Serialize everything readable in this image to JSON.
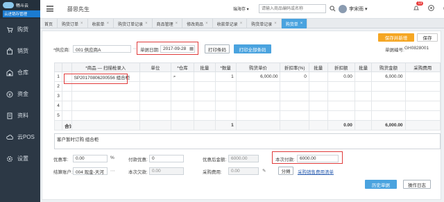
{
  "app": {
    "logo_text": "畅斗云",
    "logo_sub": "云进销存管理",
    "greeting": "薛思先生"
  },
  "sidebar": {
    "items": [
      {
        "label": "购货",
        "icon": "cart-icon"
      },
      {
        "label": "销货",
        "icon": "sales-icon"
      },
      {
        "label": "仓库",
        "icon": "warehouse-icon"
      },
      {
        "label": "资金",
        "icon": "money-icon"
      },
      {
        "label": "资料",
        "icon": "data-icon"
      },
      {
        "label": "云POS",
        "icon": "pos-icon"
      },
      {
        "label": "设置",
        "icon": "gear-icon"
      }
    ]
  },
  "header": {
    "store": "瑞海存 ▾",
    "search_placeholder": "请输入商品编码或名称",
    "user": "李宋雨 ▾",
    "badge": "13"
  },
  "tabs": [
    {
      "label": "首页",
      "active": false,
      "close": false
    },
    {
      "label": "购货订单",
      "active": false,
      "close": true
    },
    {
      "label": "收款单",
      "active": false,
      "close": true
    },
    {
      "label": "购货订单记录",
      "active": false,
      "close": true
    },
    {
      "label": "商品管理",
      "active": false,
      "close": true
    },
    {
      "label": "修改商品",
      "active": false,
      "close": true
    },
    {
      "label": "收款单记录",
      "active": false,
      "close": true
    },
    {
      "label": "购货单记录",
      "active": false,
      "close": true
    },
    {
      "label": "购货单",
      "active": true,
      "close": true
    }
  ],
  "form": {
    "save_add": "保存并新增",
    "save": "保存",
    "supplier_label": "*供应商:",
    "supplier_value": "001 供应商A",
    "date_label": "单据日期:",
    "date_value": "2017-09-28",
    "print_barcode": "打印条码",
    "print_all_barcode": "打印全部条码",
    "doc_no_label": "单据编号:",
    "doc_no_value": "GH0828001"
  },
  "table": {
    "headers": [
      "",
      "",
      "*商品 — 扫描枪录入",
      "单位",
      "*仓库",
      "批量",
      "*数量",
      "购货单价",
      "折扣率(%)",
      "批量",
      "折扣额",
      "批量",
      "购货金额",
      "采购费用"
    ],
    "rows": [
      [
        "1",
        "",
        "SP20170806200556 组合柜",
        "",
        "",
        "",
        "1",
        "6,000.00",
        "0",
        "",
        "0.00",
        "",
        "6,000.00",
        ""
      ],
      [
        "2",
        "",
        "",
        "",
        "",
        "",
        "",
        "",
        "",
        "",
        "",
        "",
        "",
        ""
      ],
      [
        "3",
        "",
        "",
        "",
        "",
        "",
        "",
        "",
        "",
        "",
        "",
        "",
        "",
        ""
      ],
      [
        "4",
        "",
        "",
        "",
        "",
        "",
        "",
        "",
        "",
        "",
        "",
        "",
        "",
        ""
      ],
      [
        "5",
        "",
        "",
        "",
        "",
        "",
        "",
        "",
        "",
        "",
        "",
        "",
        "",
        ""
      ]
    ],
    "total": [
      "",
      "合计:",
      "",
      "",
      "",
      "",
      "1",
      "",
      "",
      "",
      "0.00",
      "",
      "6,000.00",
      ""
    ]
  },
  "note": "客户暂时订购 组合柜",
  "footer": {
    "discount_rate_label": "优惠率:",
    "discount_rate_value": "0.00",
    "pct": "%",
    "discount_label": "付款优惠:",
    "discount_value": "0",
    "after_discount_label": "优惠后金额:",
    "after_discount_value": "6000.00",
    "this_pay_label": "本次付款:",
    "this_pay_value": "6000.00",
    "account_label": "结算账户:",
    "account_value": "004 现金-天河",
    "arrears_label": "本次欠款:",
    "arrears_value": "0.00",
    "purchase_fee_label": "采购费用:",
    "purchase_fee_value": "0.00",
    "split_btn": "分摊",
    "fee_link": "采购销售费用清单",
    "history_btn": "历史单据",
    "log_btn": "操作日志"
  },
  "colors": {
    "sidebar": "#2c3845",
    "accent": "#4aa3df",
    "orange": "#f5a623",
    "highlight_box": "#e03b3b"
  }
}
